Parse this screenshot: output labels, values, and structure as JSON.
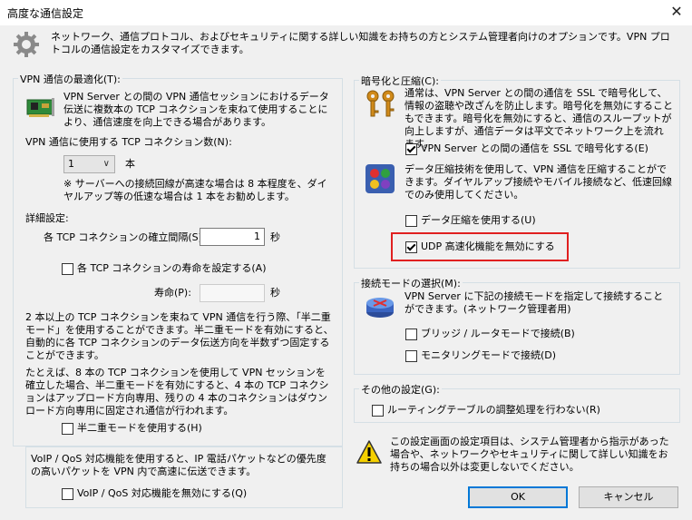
{
  "window": {
    "title": "高度な通信設定",
    "close_glyph": "✕"
  },
  "intro": "ネットワーク、通信プロトコル、およびセキュリティに関する詳しい知識をお持ちの方とシステム管理者向けのオプションです。VPN プロトコルの通信設定をカスタマイズできます。",
  "vpn_opt": {
    "group_title": "VPN 通信の最適化(T):",
    "desc": "VPN Server との間の VPN 通信セッションにおけるデータ伝送に複数本の TCP コネクションを束ねて使用することにより、通信速度を向上できる場合があります。",
    "tcp_count_label": "VPN 通信に使用する TCP コネクション数(N):",
    "tcp_count_value": "1",
    "tcp_count_unit": "本",
    "note": "※ サーバーへの接続回線が高速な場合は 8 本程度を、ダイヤルアップ等の低速な場合は 1 本をお勧めします。",
    "detail_label": "詳細設定:",
    "interval_label": "各 TCP コネクションの確立間隔(S):",
    "interval_value": "1",
    "interval_unit": "秒",
    "lifetime_checkbox": "各 TCP コネクションの寿命を設定する(A)",
    "lifetime_label": "寿命(P):",
    "lifetime_value": "",
    "lifetime_unit": "秒",
    "half_duplex_desc1": "2 本以上の TCP コネクションを束ねて VPN 通信を行う際、「半二重モード」を使用することができます。半二重モードを有効にすると、自動的に各 TCP コネクションのデータ伝送方向を半数ずつ固定することができます。",
    "half_duplex_desc2": "たとえば、8 本の TCP コネクションを使用して VPN セッションを確立した場合、半二重モードを有効にすると、4 本の TCP コネクションはアップロード方向専用、残りの 4 本のコネクションはダウンロード方向専用に固定され通信が行われます。",
    "half_duplex_checkbox": "半二重モードを使用する(H)"
  },
  "voip": {
    "desc": "VoIP / QoS 対応機能を使用すると、IP 電話パケットなどの優先度の高いパケットを VPN 内で高速に伝送できます。",
    "checkbox": "VoIP / QoS 対応機能を無効にする(Q)"
  },
  "crypto": {
    "group_title": "暗号化と圧縮(C):",
    "ssl_desc": "通常は、VPN Server との間の通信を SSL で暗号化して、情報の盗聴や改ざんを防止します。暗号化を無効にすることもできます。暗号化を無効にすると、通信のスループットが向上しますが、通信データは平文でネットワーク上を流れます。",
    "ssl_checkbox": "VPN Server との間の通信を SSL で暗号化する(E)",
    "compress_desc": "データ圧縮技術を使用して、VPN 通信を圧縮することができます。ダイヤルアップ接続やモバイル接続など、低速回線でのみ使用してください。",
    "compress_checkbox": "データ圧縮を使用する(U)",
    "udp_checkbox": "UDP 高速化機能を無効にする"
  },
  "mode": {
    "group_title": "接続モードの選択(M):",
    "desc": "VPN Server に下記の接続モードを指定して接続することができます。(ネットワーク管理者用)",
    "bridge_checkbox": "ブリッジ / ルータモードで接続(B)",
    "monitor_checkbox": "モニタリングモードで接続(D)"
  },
  "other": {
    "group_title": "その他の設定(G):",
    "routing_checkbox": "ルーティングテーブルの調整処理を行わない(R)"
  },
  "warning": "この設定画面の設定項目は、システム管理者から指示があった場合や、ネットワークやセキュリティに関して詳しい知識をお持ちの場合以外は変更しないでください。",
  "buttons": {
    "ok": "OK",
    "cancel": "キャンセル"
  },
  "state": {
    "lifetime": false,
    "half_duplex": false,
    "voip_disable": false,
    "ssl": true,
    "compress": false,
    "udp_disable": true,
    "bridge": false,
    "monitor": false,
    "routing": false
  }
}
